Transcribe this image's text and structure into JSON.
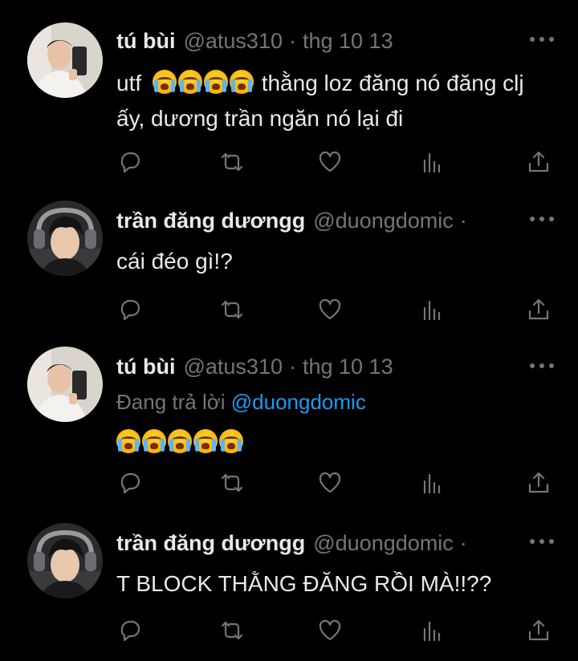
{
  "tweets": [
    {
      "name": "tú bùi",
      "handle": "@atus310",
      "separator": "·",
      "date": "thg 10 13",
      "text_before": "utf",
      "emoji_count": 4,
      "text_after": " thằng loz đăng nó đăng clj ấy, dương trần ngăn nó lại đi",
      "avatar": "avatar-tu-bui"
    },
    {
      "name": "trần đăng dươngg",
      "handle": "@duongdomic",
      "separator": "·",
      "date": "",
      "text": "cái đéo gì!?",
      "avatar": "avatar-tran-dang-duong"
    },
    {
      "name": "tú bùi",
      "handle": "@atus310",
      "separator": "·",
      "date": "thg 10 13",
      "reply_prefix": "Đang trả lời ",
      "reply_mention": "@duongdomic",
      "emoji_count": 5,
      "avatar": "avatar-tu-bui"
    },
    {
      "name": "trần đăng dươngg",
      "handle": "@duongdomic",
      "separator": "·",
      "date": "",
      "text": "T BLOCK THẰNG ĐĂNG RỒI MÀ!!??",
      "avatar": "avatar-tran-dang-duong"
    }
  ],
  "icons": {
    "reply": "reply-icon",
    "retweet": "retweet-icon",
    "like": "heart-icon",
    "views": "analytics-icon",
    "share": "share-icon",
    "more": "more-icon"
  },
  "colors": {
    "background": "#000000",
    "text": "#e7e9ea",
    "secondary": "#71767b",
    "link": "#1d9bf0"
  }
}
